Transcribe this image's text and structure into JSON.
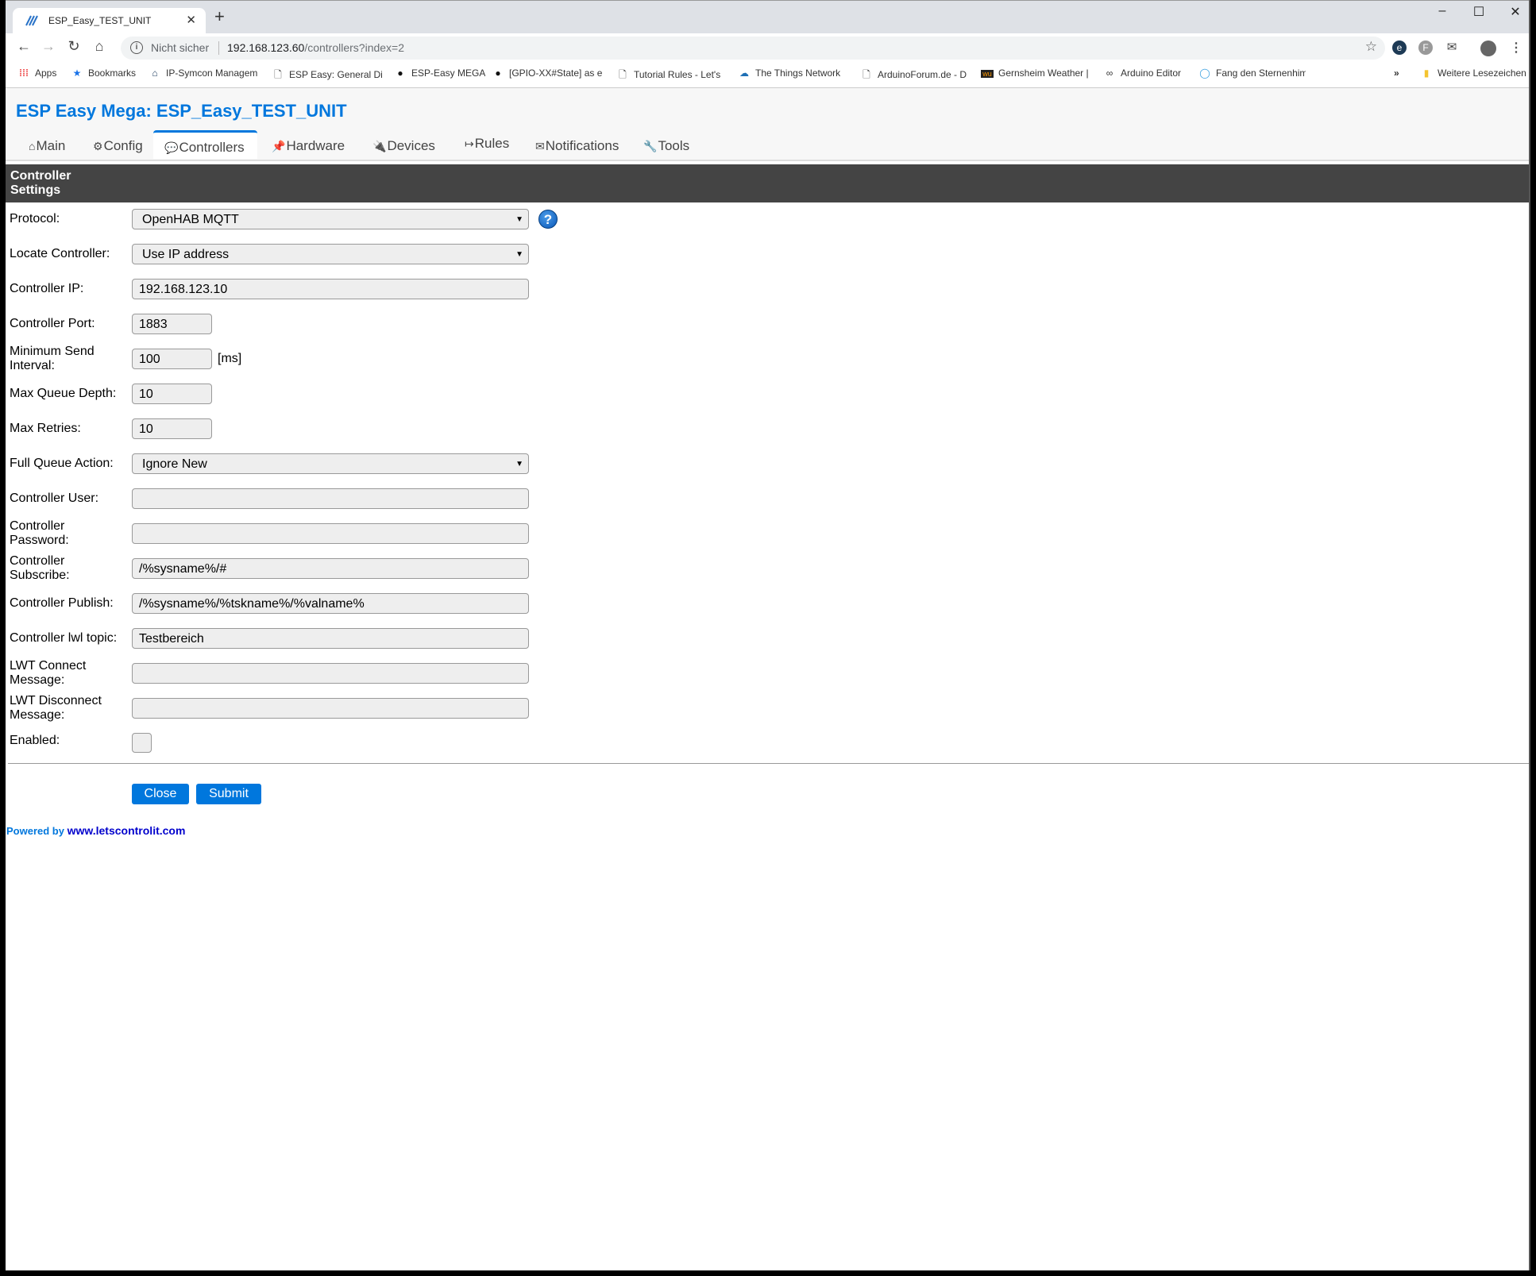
{
  "browser": {
    "tab_title": "ESP_Easy_TEST_UNIT",
    "new_tab": "+",
    "window_controls": {
      "minimize": "–",
      "maximize": "☐",
      "close": "✕"
    },
    "nav": {
      "back": "←",
      "forward": "→",
      "reload": "↻",
      "home": "⌂"
    },
    "address": {
      "security": "Nicht sicher",
      "host": "192.168.123.60",
      "path": "/controllers?index=2"
    },
    "bookmarks": [
      {
        "label": "Apps",
        "icon": "apps-grid-icon"
      },
      {
        "label": "Bookmarks",
        "icon": "star-icon"
      },
      {
        "label": "IP-Symcon Managem",
        "icon": "house-icon"
      },
      {
        "label": "ESP Easy: General Dis",
        "icon": "page-icon"
      },
      {
        "label": "ESP-Easy MEGA",
        "icon": "github-icon"
      },
      {
        "label": "[GPIO-XX#State] as e",
        "icon": "github-icon"
      },
      {
        "label": "Tutorial Rules - Let's",
        "icon": "page-icon"
      },
      {
        "label": "The Things Network",
        "icon": "cloud-icon"
      },
      {
        "label": "ArduinoForum.de - D",
        "icon": "page-icon"
      },
      {
        "label": "Gernsheim Weather |",
        "icon": "wu-icon"
      },
      {
        "label": "Arduino Editor",
        "icon": "arduino-icon"
      },
      {
        "label": "Fang den Sternenhim",
        "icon": "ring-icon"
      }
    ],
    "bookmarks_overflow": "»",
    "other_bookmarks": "Weitere Lesezeichen"
  },
  "page": {
    "title": "ESP Easy Mega: ESP_Easy_TEST_UNIT",
    "menu": [
      {
        "icon": "⌂",
        "label": "Main"
      },
      {
        "icon": "⚙",
        "label": "Config"
      },
      {
        "icon": "💬",
        "label": "Controllers",
        "active": true
      },
      {
        "icon": "📌",
        "label": "Hardware"
      },
      {
        "icon": "🔌",
        "label": "Devices"
      },
      {
        "icon": "↦",
        "label": "Rules"
      },
      {
        "icon": "✉",
        "label": "Notifications"
      },
      {
        "icon": "🔧",
        "label": "Tools"
      }
    ],
    "section_title": "Controller Settings",
    "form": {
      "protocol": {
        "label": "Protocol:",
        "value": "OpenHAB MQTT",
        "help": "?"
      },
      "locate": {
        "label": "Locate Controller:",
        "value": "Use IP address"
      },
      "ip": {
        "label": "Controller IP:",
        "value": "192.168.123.10"
      },
      "port": {
        "label": "Controller Port:",
        "value": "1883"
      },
      "min_send": {
        "label": "Minimum Send Interval:",
        "value": "100",
        "unit": "[ms]"
      },
      "queue_depth": {
        "label": "Max Queue Depth:",
        "value": "10"
      },
      "retries": {
        "label": "Max Retries:",
        "value": "10"
      },
      "full_queue": {
        "label": "Full Queue Action:",
        "value": "Ignore New"
      },
      "user": {
        "label": "Controller User:",
        "value": ""
      },
      "password": {
        "label": "Controller Password:",
        "value": ""
      },
      "subscribe": {
        "label": "Controller Subscribe:",
        "value": "/%sysname%/#"
      },
      "publish": {
        "label": "Controller Publish:",
        "value": "/%sysname%/%tskname%/%valname%"
      },
      "lwl_topic": {
        "label": "Controller lwl topic:",
        "value": "Testbereich"
      },
      "lwt_connect": {
        "label": "LWT Connect Message:",
        "value": ""
      },
      "lwt_disconnect": {
        "label": "LWT Disconnect Message:",
        "value": ""
      },
      "enabled": {
        "label": "Enabled:",
        "checked": false
      }
    },
    "buttons": {
      "close": "Close",
      "submit": "Submit"
    },
    "footer": {
      "powered_by": "Powered by",
      "link": "www.letscontrolit.com"
    }
  },
  "colors": {
    "accent": "#0077dd",
    "header_bar": "#444444",
    "input_bg": "#eeeeee"
  }
}
